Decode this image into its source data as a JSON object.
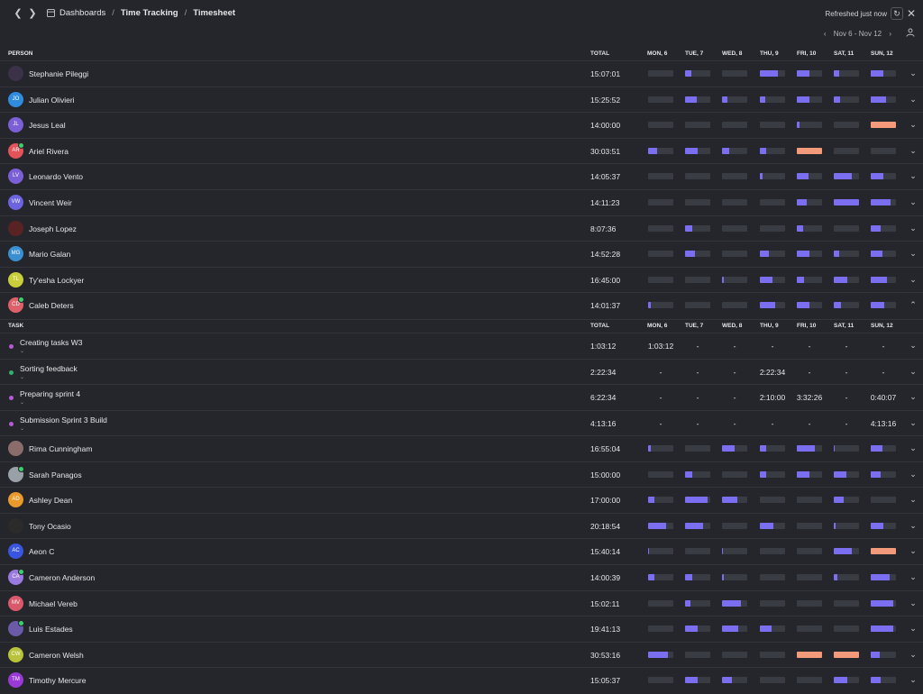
{
  "breadcrumb": [
    "Dashboards",
    "Time Tracking",
    "Timesheet"
  ],
  "refresh": {
    "text": "Refreshed just now"
  },
  "date_range": {
    "label": "Nov 6 - Nov 12"
  },
  "columns": {
    "person": "PERSON",
    "task": "TASK",
    "total": "TOTAL",
    "days": [
      "MON, 6",
      "TUE, 7",
      "WED, 8",
      "THU, 9",
      "FRI, 10",
      "SAT, 11",
      "SUN, 12"
    ]
  },
  "colors": {
    "normal": "#7b6ef0",
    "overtime": "#f39a7a",
    "empty": "#3a3c44"
  },
  "people": [
    {
      "name": "Stephanie Pileggi",
      "initials": "",
      "avatar_color": "#3b3248",
      "total": "15:07:01",
      "online": false,
      "days": [
        0,
        0.25,
        0,
        0.7,
        0.5,
        0.2,
        0.5
      ],
      "overtime": []
    },
    {
      "name": "Julian Olivieri",
      "initials": "JO",
      "avatar_color": "#2f8cdf",
      "total": "15:25:52",
      "online": false,
      "days": [
        0,
        0.45,
        0.2,
        0.2,
        0.5,
        0.25,
        0.6
      ],
      "overtime": []
    },
    {
      "name": "Jesus Leal",
      "initials": "JL",
      "avatar_color": "#7a5fd6",
      "total": "14:00:00",
      "online": false,
      "days": [
        0,
        0,
        0,
        0,
        0.1,
        0,
        1
      ],
      "overtime": [
        6
      ]
    },
    {
      "name": "Ariel Rivera",
      "initials": "AR",
      "avatar_color": "#e2545a",
      "total": "30:03:51",
      "online": true,
      "days": [
        0.35,
        0.5,
        0.3,
        0.25,
        1,
        0,
        0
      ],
      "overtime": [
        4
      ]
    },
    {
      "name": "Leonardo Vento",
      "initials": "LV",
      "avatar_color": "#7a5fd6",
      "total": "14:05:37",
      "online": false,
      "days": [
        0,
        0,
        0,
        0.1,
        0.45,
        0.7,
        0.5
      ],
      "overtime": []
    },
    {
      "name": "Vincent Weir",
      "initials": "VW",
      "avatar_color": "#6c63e0",
      "total": "14:11:23",
      "online": false,
      "days": [
        0,
        0,
        0,
        0,
        0.4,
        1,
        0.8
      ],
      "overtime": []
    },
    {
      "name": "Joseph Lopez",
      "initials": "",
      "avatar_color": "#5a2323",
      "total": "8:07:36",
      "online": false,
      "days": [
        0,
        0.3,
        0,
        0,
        0.25,
        0,
        0.4
      ],
      "overtime": []
    },
    {
      "name": "Mario Galan",
      "initials": "MG",
      "avatar_color": "#3a8fd0",
      "total": "14:52:28",
      "online": false,
      "days": [
        0,
        0.4,
        0,
        0.35,
        0.5,
        0.2,
        0.45
      ],
      "overtime": []
    },
    {
      "name": "Ty'esha Lockyer",
      "initials": "TL",
      "avatar_color": "#c8cf3a",
      "total": "16:45:00",
      "online": false,
      "days": [
        0,
        0,
        0.08,
        0.5,
        0.3,
        0.55,
        0.65
      ],
      "overtime": []
    },
    {
      "name": "Caleb Deters",
      "initials": "CD",
      "avatar_color": "#e0606a",
      "total": "14:01:37",
      "online": true,
      "days": [
        0.1,
        0,
        0,
        0.6,
        0.5,
        0.3,
        0.55
      ],
      "overtime": [],
      "expanded": true
    }
  ],
  "tasks": [
    {
      "name": "Creating tasks W3",
      "color": "#b65ad6",
      "total": "1:03:12",
      "days": [
        "1:03:12",
        "-",
        "-",
        "-",
        "-",
        "-",
        "-"
      ]
    },
    {
      "name": "Sorting feedback",
      "color": "#2fb46e",
      "total": "2:22:34",
      "days": [
        "-",
        "-",
        "-",
        "2:22:34",
        "-",
        "-",
        "-"
      ]
    },
    {
      "name": "Preparing sprint 4",
      "color": "#b65ad6",
      "total": "6:22:34",
      "days": [
        "-",
        "-",
        "-",
        "2:10:00",
        "3:32:26",
        "-",
        "0:40:07"
      ]
    },
    {
      "name": "Submission Sprint 3 Build",
      "color": "#b65ad6",
      "total": "4:13:16",
      "days": [
        "-",
        "-",
        "-",
        "-",
        "-",
        "-",
        "4:13:16"
      ]
    }
  ],
  "people2": [
    {
      "name": "Rima Cunningham",
      "initials": "",
      "avatar_color": "#8a6d6a",
      "total": "16:55:04",
      "online": false,
      "days": [
        0.12,
        0,
        0.5,
        0.25,
        0.7,
        0.05,
        0.45
      ],
      "overtime": []
    },
    {
      "name": "Sarah Panagos",
      "initials": "",
      "avatar_color": "#9aa0a8",
      "total": "15:00:00",
      "online": true,
      "days": [
        0,
        0.3,
        0,
        0.25,
        0.5,
        0.5,
        0.4
      ],
      "overtime": []
    },
    {
      "name": "Ashley Dean",
      "initials": "AD",
      "avatar_color": "#e99a2b",
      "total": "17:00:00",
      "online": false,
      "days": [
        0.25,
        0.9,
        0.6,
        0,
        0,
        0.4,
        0
      ],
      "overtime": []
    },
    {
      "name": "Tony Ocasio",
      "initials": "",
      "avatar_color": "#2b2b2b",
      "total": "20:18:54",
      "online": false,
      "days": [
        0.7,
        0.7,
        0,
        0.55,
        0,
        0.08,
        0.5
      ],
      "overtime": []
    },
    {
      "name": "Aeon C",
      "initials": "AC",
      "avatar_color": "#3a55e0",
      "total": "15:40:14",
      "online": false,
      "days": [
        0.04,
        0,
        0.04,
        0,
        0,
        0.7,
        1
      ],
      "overtime": [
        6
      ]
    },
    {
      "name": "Cameron Anderson",
      "initials": "CA",
      "avatar_color": "#9a7ae0",
      "total": "14:00:39",
      "online": true,
      "days": [
        0.25,
        0.3,
        0.07,
        0,
        0,
        0.15,
        0.75
      ],
      "overtime": []
    },
    {
      "name": "Michael Vereb",
      "initials": "MV",
      "avatar_color": "#d9596a",
      "total": "15:02:11",
      "online": false,
      "days": [
        0,
        0.2,
        0.75,
        0,
        0,
        0,
        0.9
      ],
      "overtime": []
    },
    {
      "name": "Luis Estades",
      "initials": "",
      "avatar_color": "#6a5aa8",
      "total": "19:41:13",
      "online": true,
      "days": [
        0,
        0.5,
        0.65,
        0.45,
        0,
        0,
        0.9
      ],
      "overtime": []
    },
    {
      "name": "Cameron Welsh",
      "initials": "CW",
      "avatar_color": "#b8c23a",
      "total": "30:53:16",
      "online": false,
      "days": [
        0.8,
        0,
        0,
        0,
        1,
        1,
        0.35
      ],
      "overtime": [
        4,
        5
      ]
    },
    {
      "name": "Timothy Mercure",
      "initials": "TM",
      "avatar_color": "#9a3ad6",
      "total": "15:05:37",
      "online": false,
      "days": [
        0,
        0.5,
        0.4,
        0,
        0,
        0.55,
        0.4
      ],
      "overtime": []
    }
  ]
}
